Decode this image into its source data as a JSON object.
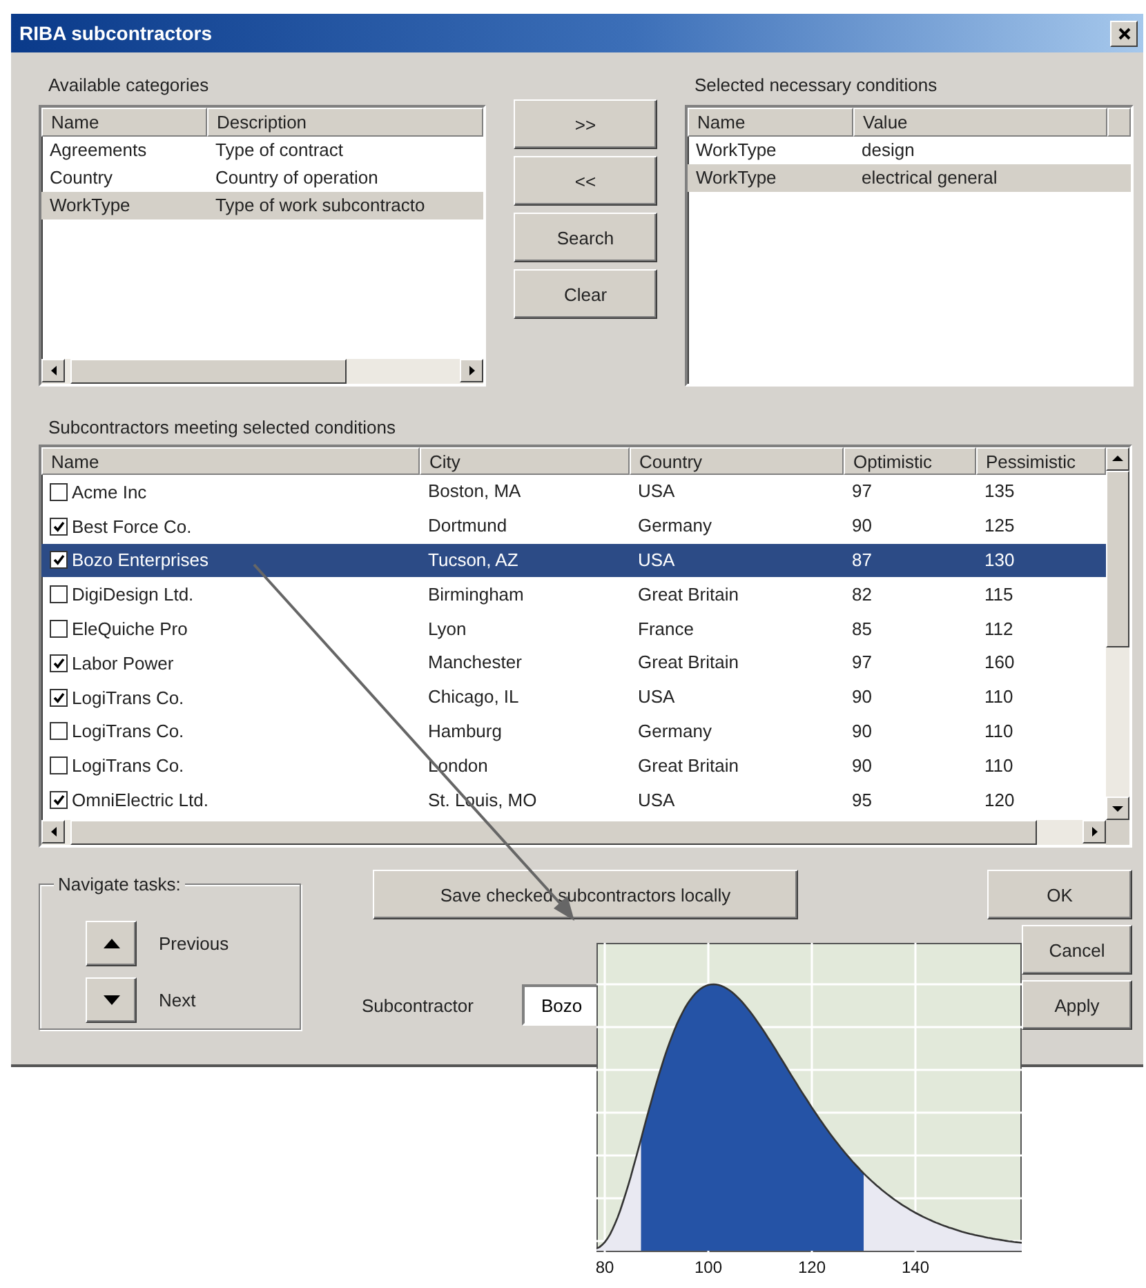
{
  "window": {
    "title": "RIBA subcontractors"
  },
  "available_categories": {
    "label": "Available categories",
    "columns": [
      "Name",
      "Description"
    ],
    "rows": [
      {
        "cells": [
          "Agreements",
          "Type of contract"
        ],
        "selected": false
      },
      {
        "cells": [
          "Country",
          "Country of operation"
        ],
        "selected": false
      },
      {
        "cells": [
          "WorkType",
          "Type of work subcontracto"
        ],
        "selected": true
      }
    ]
  },
  "transfer_buttons": [
    ">>",
    "<<",
    "Search",
    "Clear"
  ],
  "selected_conditions": {
    "label": "Selected necessary conditions",
    "columns": [
      "Name",
      "Value"
    ],
    "rows": [
      {
        "cells": [
          "WorkType",
          "design"
        ],
        "selected": false
      },
      {
        "cells": [
          "WorkType",
          "electrical general"
        ],
        "selected": true
      }
    ]
  },
  "subcontractors": {
    "label": "Subcontractors meeting selected conditions",
    "columns": [
      "Name",
      "City",
      "Country",
      "Optimistic",
      "Pessimistic"
    ],
    "rows": [
      {
        "cells": [
          "Acme Inc",
          "Boston, MA",
          "USA",
          "97",
          "135"
        ],
        "checked": false,
        "selected": false
      },
      {
        "cells": [
          "Best Force Co.",
          "Dortmund",
          "Germany",
          "90",
          "125"
        ],
        "checked": true,
        "selected": false
      },
      {
        "cells": [
          "Bozo Enterprises",
          "Tucson, AZ",
          "USA",
          "87",
          "130"
        ],
        "checked": true,
        "selected": true
      },
      {
        "cells": [
          "DigiDesign Ltd.",
          "Birmingham",
          "Great Britain",
          "82",
          "115"
        ],
        "checked": false,
        "selected": false
      },
      {
        "cells": [
          "EleQuiche Pro",
          "Lyon",
          "France",
          "85",
          "112"
        ],
        "checked": false,
        "selected": false
      },
      {
        "cells": [
          "Labor Power",
          "Manchester",
          "Great Britain",
          "97",
          "160"
        ],
        "checked": true,
        "selected": false
      },
      {
        "cells": [
          "LogiTrans Co.",
          "Chicago, IL",
          "USA",
          "90",
          "110"
        ],
        "checked": true,
        "selected": false
      },
      {
        "cells": [
          "LogiTrans Co.",
          "Hamburg",
          "Germany",
          "90",
          "110"
        ],
        "checked": false,
        "selected": false
      },
      {
        "cells": [
          "LogiTrans Co.",
          "London",
          "Great Britain",
          "90",
          "110"
        ],
        "checked": false,
        "selected": false
      },
      {
        "cells": [
          "OmniElectric Ltd.",
          "St. Louis, MO",
          "USA",
          "95",
          "120"
        ],
        "checked": true,
        "selected": false
      }
    ]
  },
  "navigate": {
    "label": "Navigate tasks:",
    "items": [
      {
        "kind": "up",
        "label": "Previous"
      },
      {
        "kind": "down",
        "label": "Next"
      }
    ]
  },
  "save_button": "Save checked subcontractors locally",
  "dialog_buttons": [
    "OK",
    "Cancel",
    "Apply"
  ],
  "subcontractor_field": {
    "label": "Subcontractor",
    "value": "Bozo"
  },
  "distribution_plot": {
    "x_tick_labels": [
      "80",
      "100",
      "120",
      "140"
    ]
  }
}
